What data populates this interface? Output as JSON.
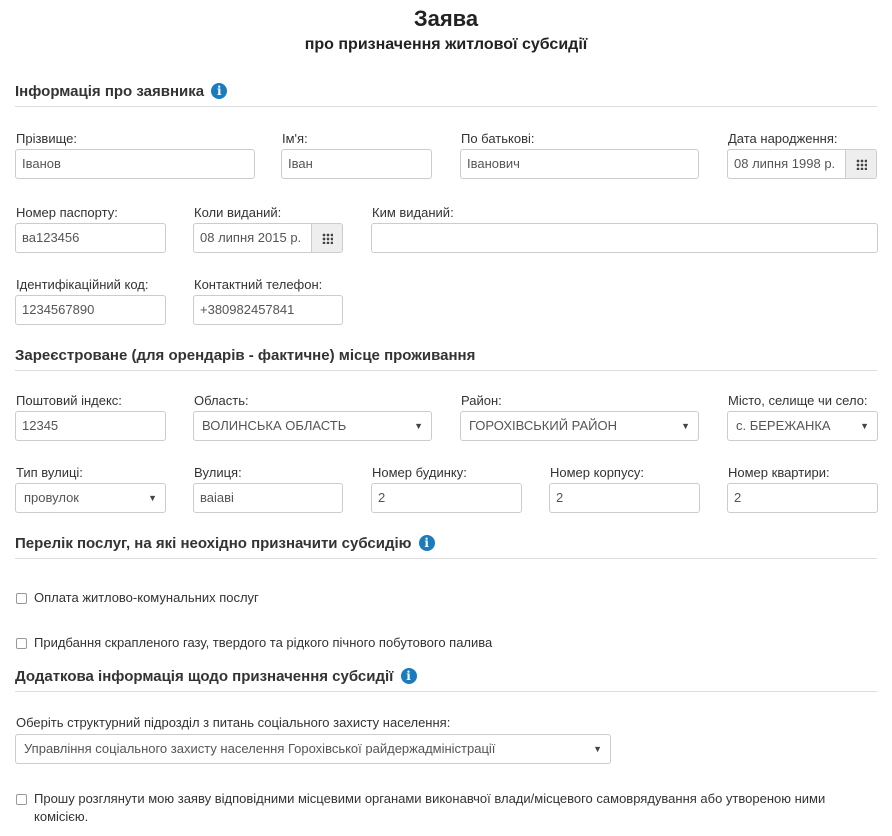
{
  "header": {
    "title": "Заява",
    "subtitle": "про призначення житлової субсидії"
  },
  "sections": {
    "applicant": "Інформація про заявника",
    "residence": "Зареєстроване (для орендарів - фактичне) місце проживання",
    "services": "Перелік послуг, на які неохідно призначити субсидію",
    "additional": "Додаткова інформація щодо призначення субсидії"
  },
  "applicant": {
    "surname_label": "Прізвище:",
    "surname": "Іванов",
    "name_label": "Ім'я:",
    "name": "Іван",
    "patronymic_label": "По батькові:",
    "patronymic": "Іванович",
    "birthdate_label": "Дата народження:",
    "birthdate": "08 липня 1998 р.",
    "passport_label": "Номер паспорту:",
    "passport": "ва123456",
    "issued_date_label": "Коли виданий:",
    "issued_date": "08 липня 2015 р.",
    "issued_by_label": "Ким виданий:",
    "issued_by": "",
    "tax_id_label": "Ідентифікаційний код:",
    "tax_id": "1234567890",
    "phone_label": "Контактний телефон:",
    "phone": "+380982457841"
  },
  "residence": {
    "postal_label": "Поштовий індекс:",
    "postal": "12345",
    "region_label": "Область:",
    "region": "ВОЛИНСЬКА ОБЛАСТЬ",
    "district_label": "Район:",
    "district": "ГОРОХІВСЬКИЙ РАЙОН",
    "city_label": "Місто, селище чи село:",
    "city": "с. БЕРЕЖАНКА",
    "street_type_label": "Тип вулиці:",
    "street_type": "провулок",
    "street_label": "Вулиця:",
    "street": "ваіаві",
    "house_label": "Номер будинку:",
    "house": "2",
    "building_label": "Номер корпусу:",
    "building": "2",
    "apartment_label": "Номер квартири:",
    "apartment": "2"
  },
  "services": {
    "utilities": "Оплата житлово-комунальних послуг",
    "fuel": "Придбання скрапленого газу, твердого та рідкого пічного побутового палива"
  },
  "additional": {
    "department_label": "Оберіть структурний підрозділ з питань соціального захисту населення:",
    "department": "Управління соціального захисту населення Горохівської райдержадміністрації",
    "consent": "Прошу розглянути мою заяву відповідними місцевими органами виконавчої влади/місцевого самоврядування або утвореною ними комісією."
  },
  "icons": {
    "info": "i",
    "caret": "▼"
  },
  "colors": {
    "info_icon": "#1a7bbf",
    "border": "#cccccc"
  }
}
